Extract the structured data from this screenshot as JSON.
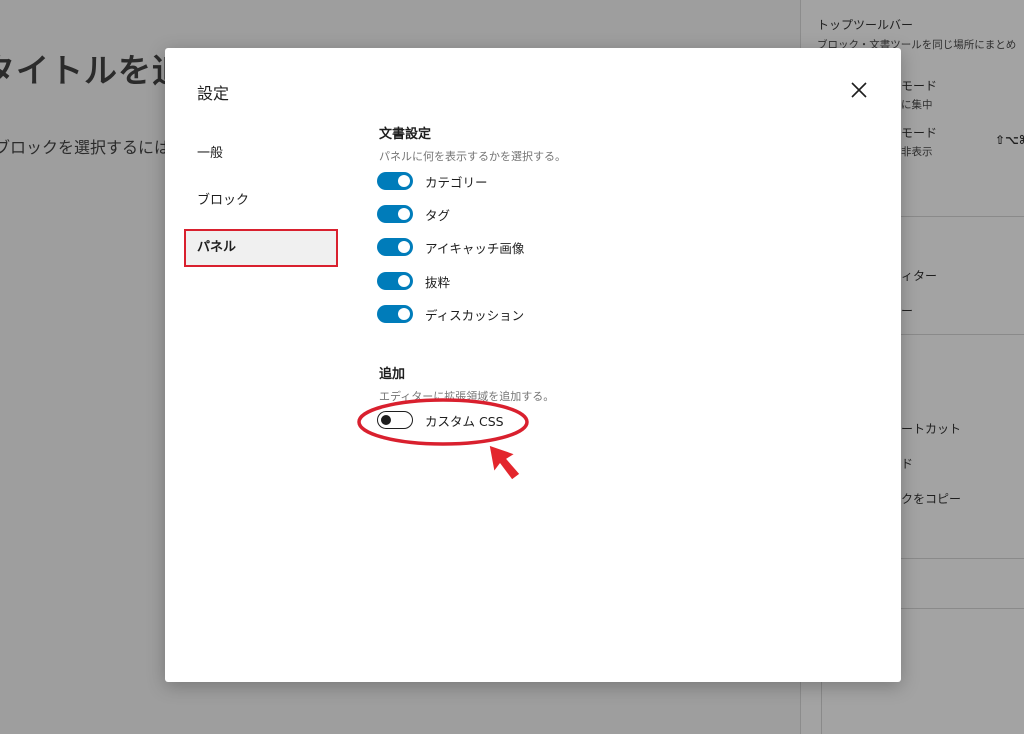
{
  "background": {
    "editor_title": "タイトルを追加",
    "editor_hint": "ブロックを選択するには",
    "sidebar": {
      "top_toolbar_title": "トップツールバー",
      "top_toolbar_desc": "ブロック・文書ツールを同じ場所にまとめ",
      "spotlight_label": "モード",
      "spotlight_desc": "に集中",
      "distraction_label": "モード",
      "distraction_desc": "非表示",
      "distraction_shortcut": "⇧⌥⌘",
      "code_editor": "ィター",
      "code_editor_shortcut": "ー",
      "shortcuts": "ートカット",
      "mode": "ド",
      "copy": "クをコピー"
    }
  },
  "modal": {
    "title": "設定",
    "close_icon": "close-icon",
    "nav": [
      {
        "label": "一般",
        "active": false
      },
      {
        "label": "ブロック",
        "active": false
      },
      {
        "label": "パネル",
        "active": true
      }
    ],
    "document_settings": {
      "title": "文書設定",
      "description": "パネルに何を表示するかを選択する。",
      "options": [
        {
          "label": "カテゴリー",
          "enabled": true
        },
        {
          "label": "タグ",
          "enabled": true
        },
        {
          "label": "アイキャッチ画像",
          "enabled": true
        },
        {
          "label": "抜粋",
          "enabled": true
        },
        {
          "label": "ディスカッション",
          "enabled": true
        }
      ]
    },
    "additional": {
      "title": "追加",
      "description": "エディターに拡張領域を追加する。",
      "options": [
        {
          "label": "カスタム CSS",
          "enabled": false
        }
      ]
    }
  },
  "colors": {
    "toggle_on": "#007cba",
    "annotation_red": "#d9202e"
  }
}
